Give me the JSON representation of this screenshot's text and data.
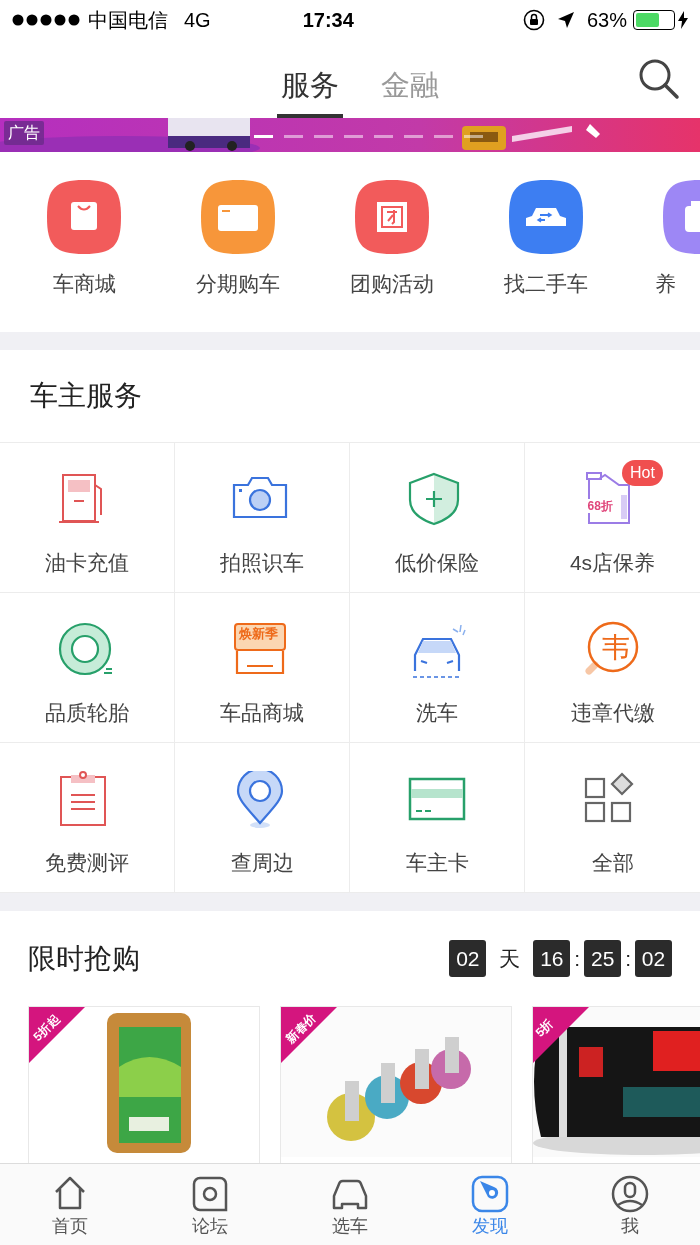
{
  "status_bar": {
    "carrier": "中国电信",
    "network": "4G",
    "time": "17:34",
    "battery": "63%"
  },
  "header": {
    "tabs": [
      {
        "label": "服务",
        "selected": true
      },
      {
        "label": "金融",
        "selected": false
      }
    ]
  },
  "banner": {
    "kind": "picture",
    "ad_label": "广告",
    "slides": [
      {
        "selected": true
      },
      {
        "selected": false
      },
      {
        "selected": false
      },
      {
        "selected": false
      },
      {
        "selected": false
      },
      {
        "selected": false
      },
      {
        "selected": false
      },
      {
        "selected": false
      }
    ]
  },
  "shortcuts": [
    {
      "label": "车商城",
      "color": "#f25b5b"
    },
    {
      "label": "分期购车",
      "color": "#f7963a"
    },
    {
      "label": "团购活动",
      "color": "#f25b5b"
    },
    {
      "label": "找二手车",
      "color": "#3d7ef2"
    },
    {
      "label": "养",
      "color": "#9d87f5"
    }
  ],
  "owner_services": {
    "title": "车主服务",
    "items": [
      {
        "label": "油卡充值"
      },
      {
        "label": "拍照识车"
      },
      {
        "label": "低价保险"
      },
      {
        "label": "4s店保养",
        "badge": "Hot",
        "icon_text": "68折"
      },
      {
        "label": "品质轮胎"
      },
      {
        "label": "车品商城",
        "icon_text": "焕新季"
      },
      {
        "label": "洗车"
      },
      {
        "label": "违章代缴",
        "icon_text": "韦"
      },
      {
        "label": "免费测评"
      },
      {
        "label": "查周边"
      },
      {
        "label": "车主卡"
      },
      {
        "label": "全部"
      }
    ]
  },
  "flash_sale": {
    "title": "限时抢购",
    "countdown": [
      {
        "kind": "box",
        "text": "02"
      },
      {
        "kind": "unit",
        "text": "天"
      },
      {
        "kind": "box",
        "text": "16"
      },
      {
        "kind": "sep",
        "text": ":"
      },
      {
        "kind": "box",
        "text": "25"
      },
      {
        "kind": "sep",
        "text": ":"
      },
      {
        "kind": "box",
        "text": "02"
      }
    ],
    "products": [
      {
        "tag": "5折起",
        "kind": "picture"
      },
      {
        "tag": "新春价",
        "kind": "picture"
      },
      {
        "tag": "5折",
        "kind": "picture"
      }
    ]
  },
  "tab_bar": [
    {
      "label": "首页",
      "selected": false
    },
    {
      "label": "论坛",
      "selected": false
    },
    {
      "label": "选车",
      "selected": false
    },
    {
      "label": "发现",
      "selected": true
    },
    {
      "label": "我",
      "selected": false
    }
  ]
}
